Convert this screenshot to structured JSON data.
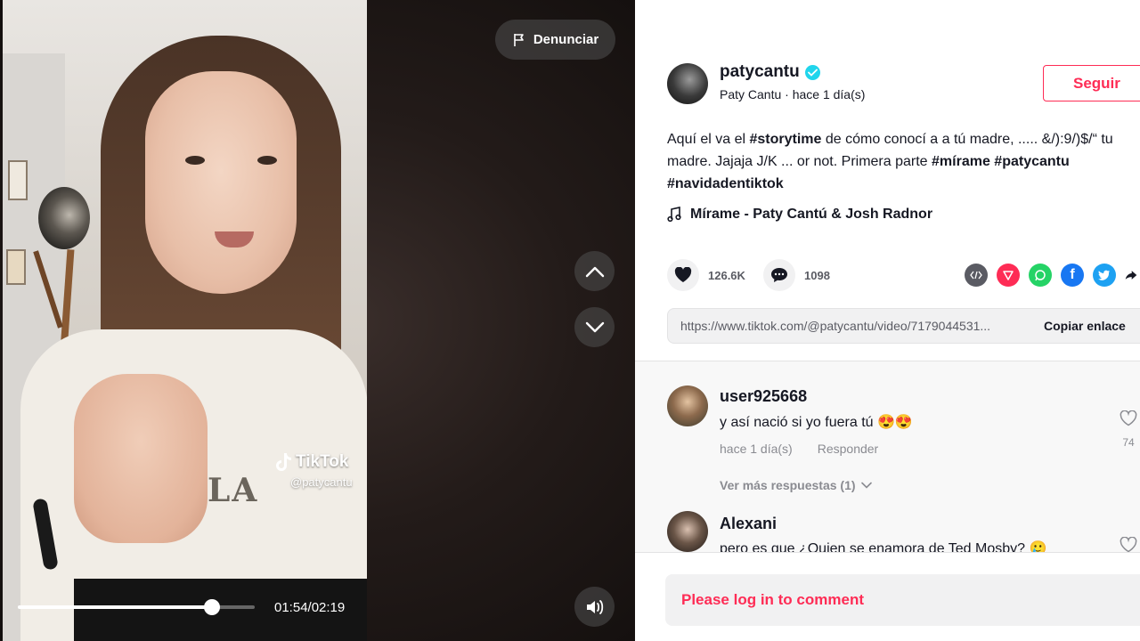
{
  "video": {
    "report_label": "Denunciar",
    "watermark_brand": "TikTok",
    "watermark_user": "@patycantu",
    "progress_fraction": 0.82,
    "time_display": "01:54/02:19"
  },
  "author": {
    "username": "patycantu",
    "subline": "Paty Cantu · hace 1 día(s)",
    "follow_label": "Seguir"
  },
  "description": {
    "segments": [
      {
        "text": "Aquí el va el ",
        "tag": false
      },
      {
        "text": "#storytime",
        "tag": true
      },
      {
        "text": " de cómo conocí a a tú madre, ..... &/):9/)$/“ tu madre. Jajaja J/K ... or not. Primera parte ",
        "tag": false
      },
      {
        "text": "#mírame",
        "tag": true
      },
      {
        "text": " ",
        "tag": false
      },
      {
        "text": "#patycantu",
        "tag": true
      },
      {
        "text": " ",
        "tag": false
      },
      {
        "text": "#navidadentiktok",
        "tag": true
      }
    ]
  },
  "music": "Mírame - Paty Cantú & Josh Radnor",
  "stats": {
    "likes": "126.6K",
    "comments": "1098"
  },
  "share": {
    "icons": [
      "embed-icon",
      "send-icon",
      "whatsapp-icon",
      "facebook-icon",
      "twitter-icon",
      "share-arrow-icon"
    ],
    "colors": [
      "#5a5b63",
      "#fe2c55",
      "#25d366",
      "#1877f2",
      "#1da1f2",
      "#161823"
    ]
  },
  "link": {
    "url": "https://www.tiktok.com/@patycantu/video/7179044531...",
    "copy_label": "Copiar enlace"
  },
  "comments": [
    {
      "user": "user925668",
      "text": "y así nació si yo fuera tú 😍😍",
      "time": "hace 1 día(s)",
      "reply": "Responder",
      "likes": "74",
      "more_replies": "Ver más respuestas (1)"
    },
    {
      "user": "Alexani",
      "text": "pero es que ¿Quien se enamora de Ted Mosby? 🥲"
    }
  ],
  "login_prompt": "Please log in to comment"
}
